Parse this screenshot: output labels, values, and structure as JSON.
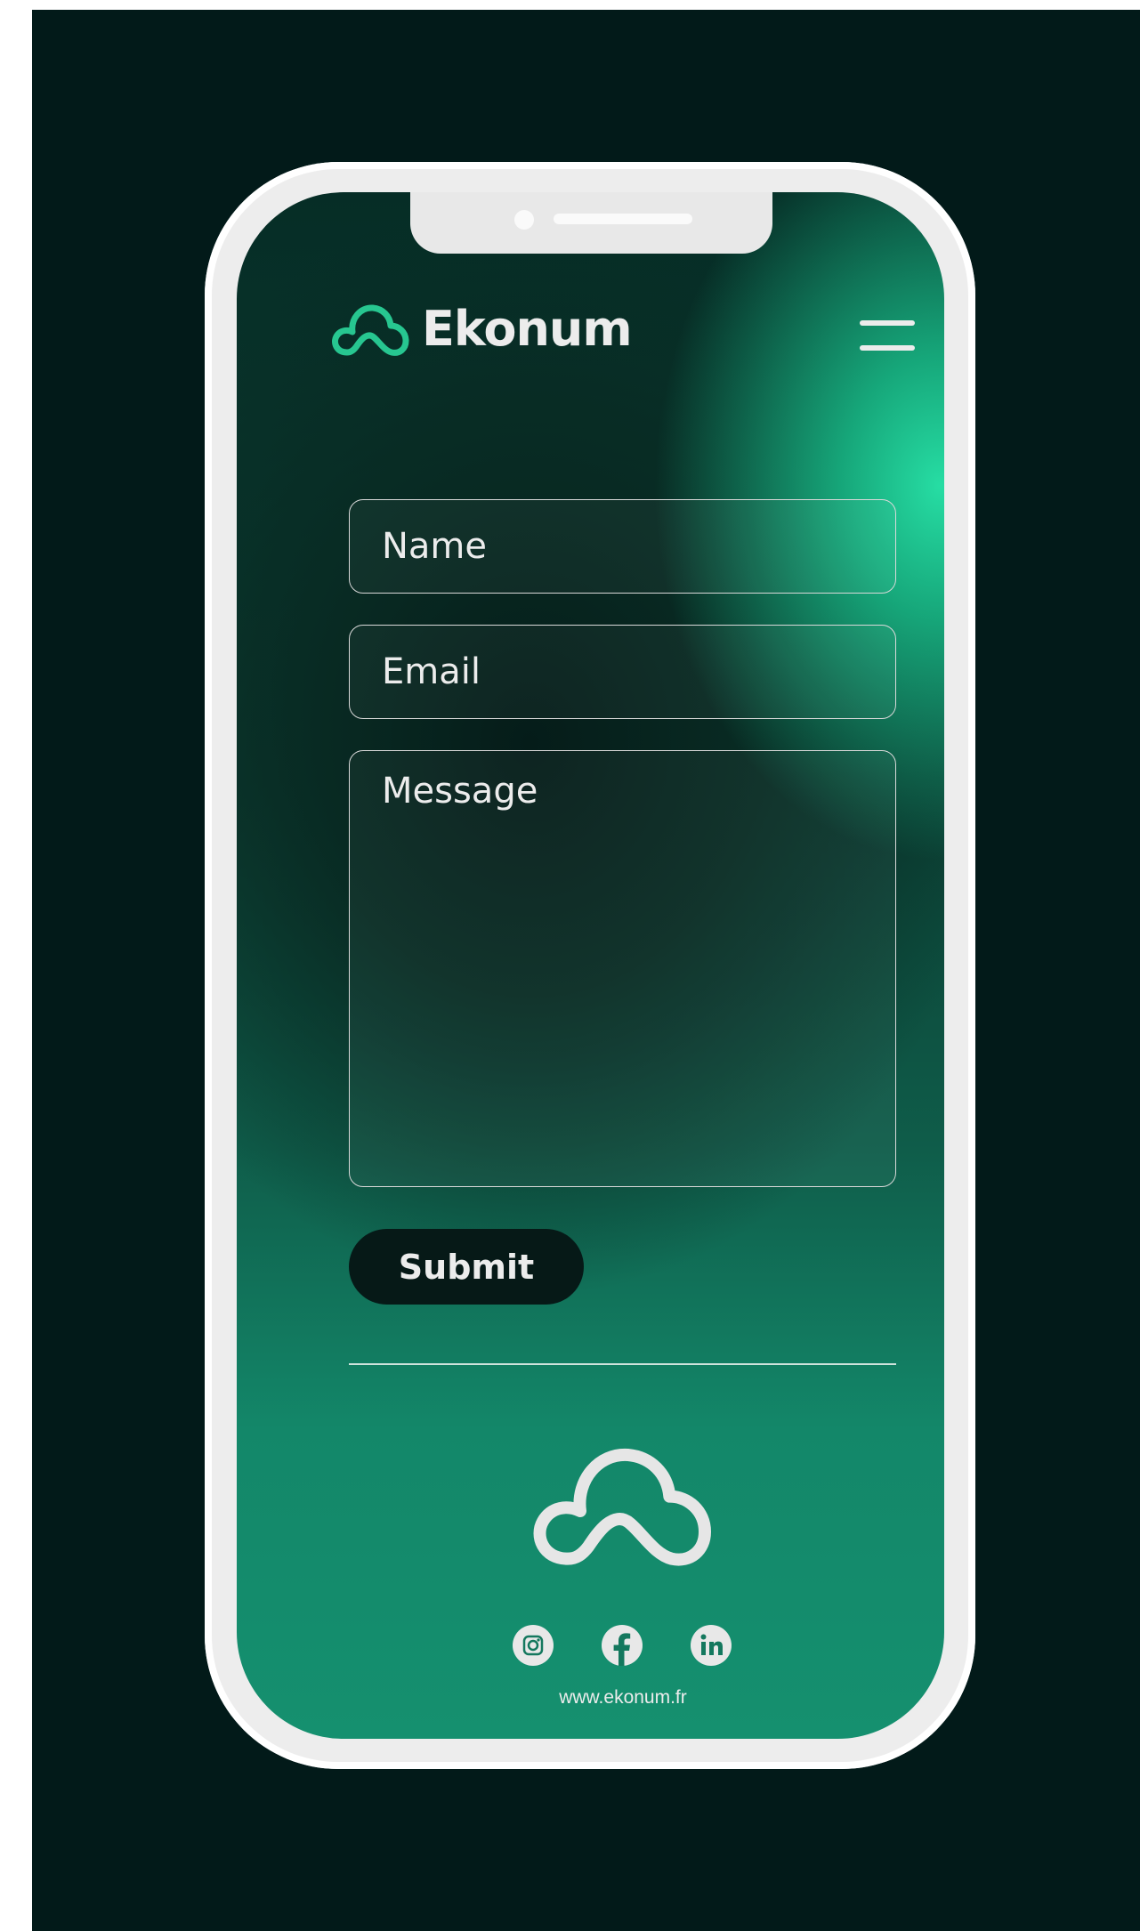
{
  "brand": {
    "name": "Ekonum",
    "logo_icon": "cloud-icon"
  },
  "header": {
    "menu_icon": "hamburger-menu-icon"
  },
  "form": {
    "name_placeholder": "Name",
    "email_placeholder": "Email",
    "message_placeholder": "Message",
    "submit_label": "Submit"
  },
  "footer": {
    "logo_icon": "cloud-icon",
    "social": [
      "instagram-icon",
      "facebook-icon",
      "linkedin-icon"
    ],
    "website": "www.ekonum.fr"
  },
  "colors": {
    "background": "#021a19",
    "accent": "#27c690",
    "text": "#ececec",
    "button": "#061917",
    "frame": "#ededed"
  }
}
